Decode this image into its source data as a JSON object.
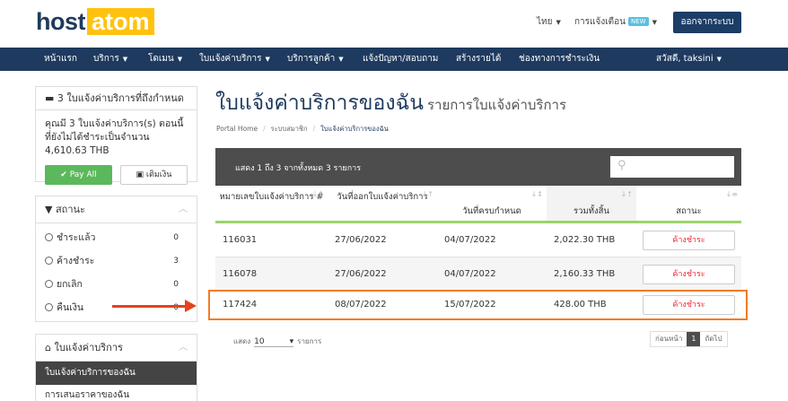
{
  "brand": {
    "host": "host",
    "atom": "atom"
  },
  "header": {
    "language": "ไทย",
    "notifications": "การแจ้งเตือน",
    "new_badge": "NEW",
    "logout": "ออกจากระบบ"
  },
  "nav": {
    "items": [
      "หน้าแรก",
      "บริการ",
      "โดเมน",
      "ใบแจ้งค่าบริการ",
      "บริการลูกค้า",
      "แจ้งปัญหา/สอบถาม",
      "สร้างรายได้",
      "ช่องทางการชำระเงิน"
    ],
    "user": "สวัสดี, taksini"
  },
  "sidebar": {
    "due_title": "3 ใบแจ้งค่าบริการที่ถึงกำหนด",
    "due_text": "คุณมี 3 ใบแจ้งค่าบริการ(s) ตอนนี้ที่ยังไม่ได้ชำระเป็นจำนวน 4,610.63 THB",
    "pay_all": "Pay All",
    "add_funds": "เติมเงิน",
    "status_title": "สถานะ",
    "statuses": [
      {
        "label": "ชำระแล้ว",
        "count": "0"
      },
      {
        "label": "ค้างชำระ",
        "count": "3"
      },
      {
        "label": "ยกเลิก",
        "count": "0"
      },
      {
        "label": "คืนเงิน",
        "count": "0"
      }
    ],
    "invoices_title": "ใบแจ้งค่าบริการ",
    "menu_active": "ใบแจ้งค่าบริการของฉัน",
    "menu_next": "การเสนอราคาของฉัน"
  },
  "main": {
    "title": "ใบแจ้งค่าบริการของฉัน",
    "subtitle": "รายการใบแจ้งค่าบริการ",
    "breadcrumb": [
      "Portal Home",
      "ระบบสมาชิก",
      "ใบแจ้งค่าบริการของฉัน"
    ],
    "table_info": "แสดง 1 ถึง 3 จากทั้งหมด 3 รายการ",
    "columns": [
      "หมายเลขใบแจ้งค่าบริการ #",
      "วันที่ออกใบแจ้งค่าบริการ",
      "วันที่ครบกำหนด",
      "รวมทั้งสิ้น",
      "สถานะ"
    ],
    "rows": [
      {
        "id": "116031",
        "issued": "27/06/2022",
        "due": "04/07/2022",
        "total": "2,022.30 THB",
        "status": "ค้างชำระ"
      },
      {
        "id": "116078",
        "issued": "27/06/2022",
        "due": "04/07/2022",
        "total": "2,160.33 THB",
        "status": "ค้างชำระ"
      },
      {
        "id": "117424",
        "issued": "08/07/2022",
        "due": "15/07/2022",
        "total": "428.00 THB",
        "status": "ค้างชำระ"
      }
    ],
    "show_label": "แสดง",
    "show_value": "10",
    "entries_label": "รายการ",
    "pager": {
      "prev": "ก่อนหน้า",
      "page": "1",
      "next": "ถัดไป"
    }
  }
}
